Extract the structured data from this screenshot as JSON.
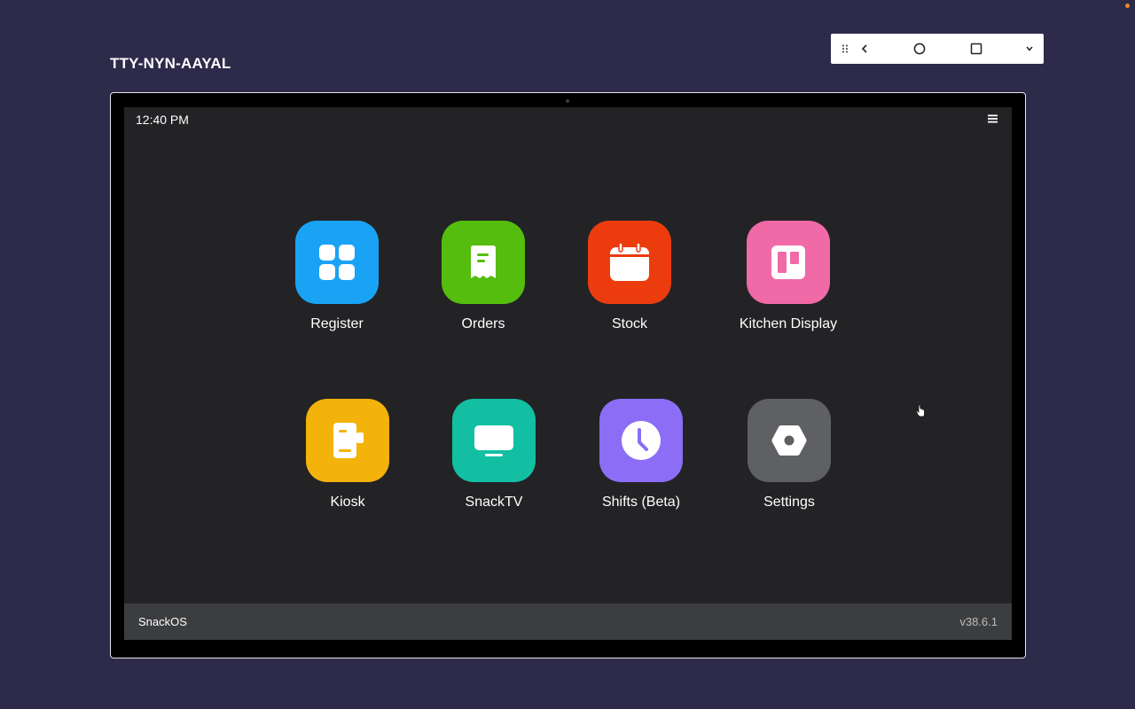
{
  "device": {
    "title": "TTY-NYN-AAYAL"
  },
  "toolbar": {
    "items": [
      {
        "icon": "drag-handle-icon"
      },
      {
        "icon": "chevron-left-icon"
      },
      {
        "icon": "circle-home-icon"
      },
      {
        "icon": "square-recents-icon"
      },
      {
        "icon": "chevron-down-icon"
      }
    ]
  },
  "screen": {
    "time": "12:40 PM",
    "menu_icon": "hamburger-menu-icon",
    "apps": [
      {
        "label": "Register",
        "color": "#1aa3f5",
        "icon": "grid-icon"
      },
      {
        "label": "Orders",
        "color": "#54bd0d",
        "icon": "receipt-icon"
      },
      {
        "label": "Stock",
        "color": "#ec3c0e",
        "icon": "calendar-icon"
      },
      {
        "label": "Kitchen Display",
        "color": "#ef6aa7",
        "icon": "board-icon"
      },
      {
        "label": "Kiosk",
        "color": "#f4b30a",
        "icon": "kiosk-icon"
      },
      {
        "label": "SnackTV",
        "color": "#12bfa3",
        "icon": "monitor-icon"
      },
      {
        "label": "Shifts (Beta)",
        "color": "#8b6ef5",
        "icon": "clock-icon"
      },
      {
        "label": "Settings",
        "color": "#5e6063",
        "icon": "gear-icon"
      }
    ],
    "taskbar": {
      "os_name": "SnackOS",
      "version": "v38.6.1"
    }
  },
  "colors": {
    "page_background": "#2d2a4a",
    "screen_background": "#232326",
    "taskbar_background": "#3c3d3f"
  }
}
